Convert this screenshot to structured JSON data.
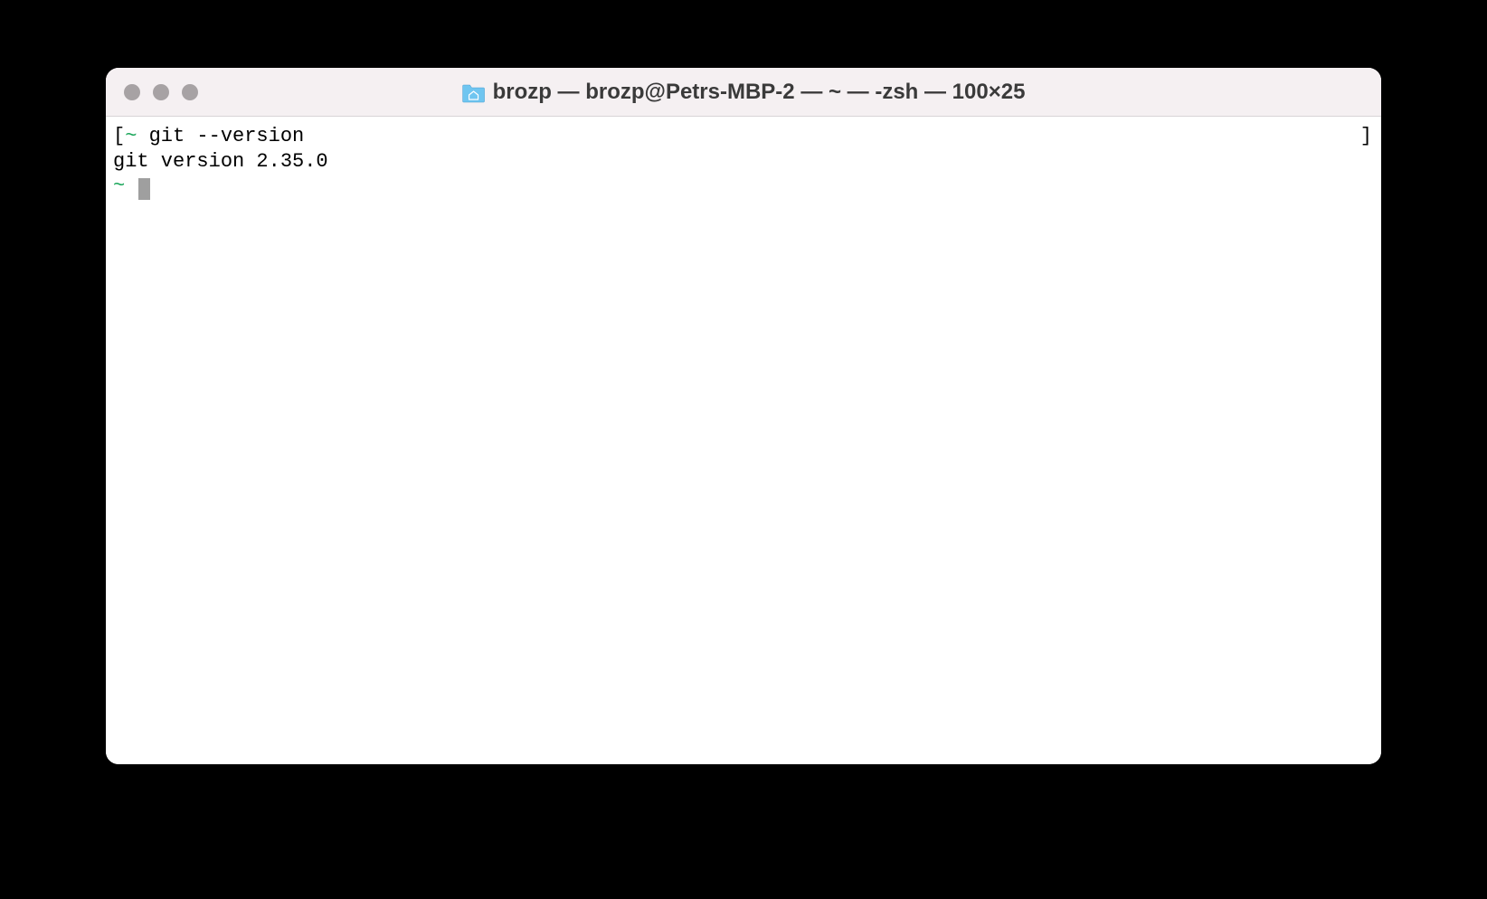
{
  "titlebar": {
    "title": "brozp — brozp@Petrs-MBP-2 — ~ — -zsh — 100×25"
  },
  "terminal": {
    "line1_bracket": "[",
    "line1_tilde": "~",
    "line1_cmd": " git --version",
    "line1_rbracket": "]",
    "line2": "git version 2.35.0",
    "line3_tilde": "~"
  }
}
